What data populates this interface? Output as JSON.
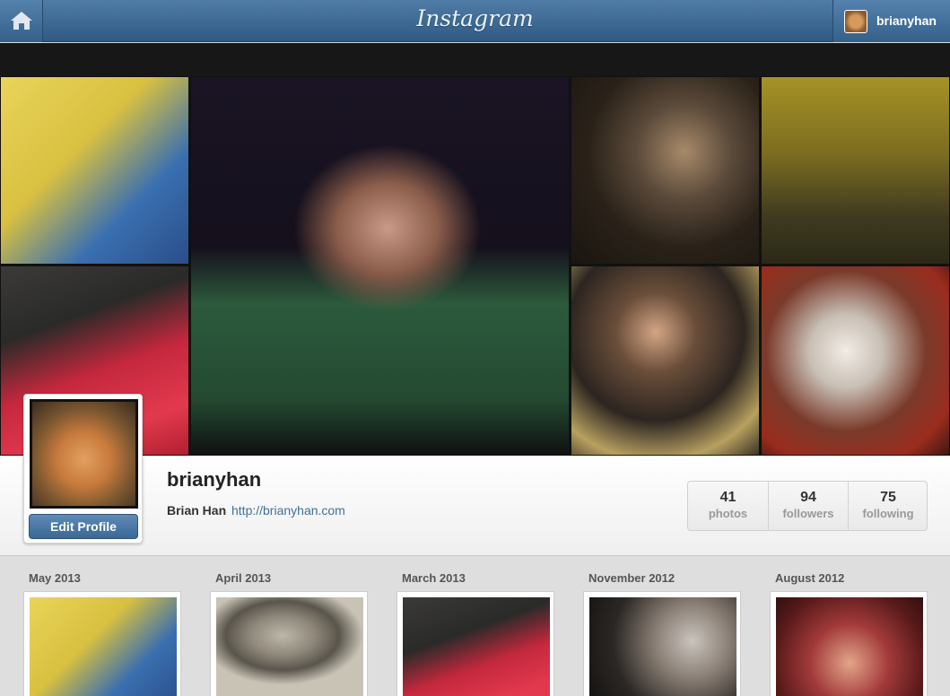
{
  "header": {
    "logo": "Instagram",
    "username": "brianyhan"
  },
  "profile": {
    "username": "brianyhan",
    "full_name": "Brian Han",
    "website": "http://brianyhan.com",
    "edit_label": "Edit Profile"
  },
  "stats": [
    {
      "value": "41",
      "label": "photos"
    },
    {
      "value": "94",
      "label": "followers"
    },
    {
      "value": "75",
      "label": "following"
    }
  ],
  "timeline": [
    {
      "month": "May 2013"
    },
    {
      "month": "April 2013"
    },
    {
      "month": "March 2013"
    },
    {
      "month": "November 2012"
    },
    {
      "month": "August 2012"
    }
  ],
  "colors": {
    "header": "#3b6894",
    "link": "#3f729b"
  },
  "icons": [
    "home-icon"
  ]
}
